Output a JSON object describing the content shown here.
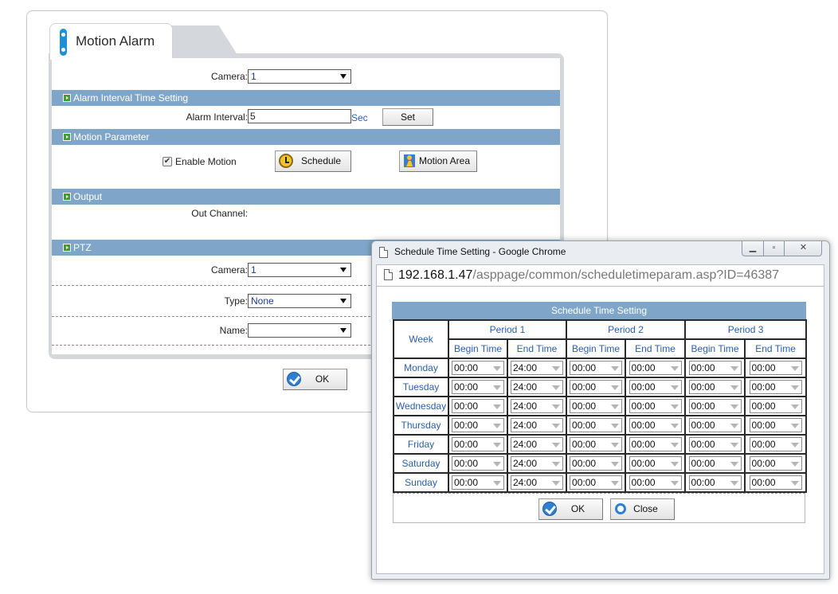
{
  "main": {
    "tab_title": "Motion Alarm",
    "camera_label": "Camera:",
    "camera_value": "1",
    "sections": {
      "alarm_interval": "Alarm Interval Time Setting",
      "motion_parameter": "Motion Parameter",
      "output": "Output",
      "ptz": "PTZ"
    },
    "alarm_interval_label": "Alarm Interval:",
    "alarm_interval_value": "5",
    "alarm_interval_unit": "Sec",
    "set_button": "Set",
    "enable_motion_label": "Enable Motion",
    "enable_motion_checked": true,
    "schedule_button": "Schedule",
    "motion_area_button": "Motion Area",
    "out_channel_label": "Out Channel:",
    "ptz_camera_label": "Camera:",
    "ptz_camera_value": "1",
    "type_label": "Type:",
    "type_value": "None",
    "name_label": "Name:",
    "name_value": "",
    "ok_button": "OK"
  },
  "popup": {
    "window_title": "Schedule Time Setting - Google Chrome",
    "url_host": "192.168.1.47",
    "url_path": "/asppage/common/scheduletimeparam.asp?ID=46387",
    "header": "Schedule Time Setting",
    "week_label": "Week",
    "periods": [
      "Period 1",
      "Period 2",
      "Period 3"
    ],
    "begin_label": "Begin Time",
    "end_label": "End Time",
    "rows": [
      {
        "day": "Monday",
        "times": [
          "00:00",
          "24:00",
          "00:00",
          "00:00",
          "00:00",
          "00:00"
        ]
      },
      {
        "day": "Tuesday",
        "times": [
          "00:00",
          "24:00",
          "00:00",
          "00:00",
          "00:00",
          "00:00"
        ]
      },
      {
        "day": "Wednesday",
        "times": [
          "00:00",
          "24:00",
          "00:00",
          "00:00",
          "00:00",
          "00:00"
        ]
      },
      {
        "day": "Thursday",
        "times": [
          "00:00",
          "24:00",
          "00:00",
          "00:00",
          "00:00",
          "00:00"
        ]
      },
      {
        "day": "Friday",
        "times": [
          "00:00",
          "24:00",
          "00:00",
          "00:00",
          "00:00",
          "00:00"
        ]
      },
      {
        "day": "Saturday",
        "times": [
          "00:00",
          "24:00",
          "00:00",
          "00:00",
          "00:00",
          "00:00"
        ]
      },
      {
        "day": "Sunday",
        "times": [
          "00:00",
          "24:00",
          "00:00",
          "00:00",
          "00:00",
          "00:00"
        ]
      }
    ],
    "ok_button": "OK",
    "close_button": "Close"
  }
}
